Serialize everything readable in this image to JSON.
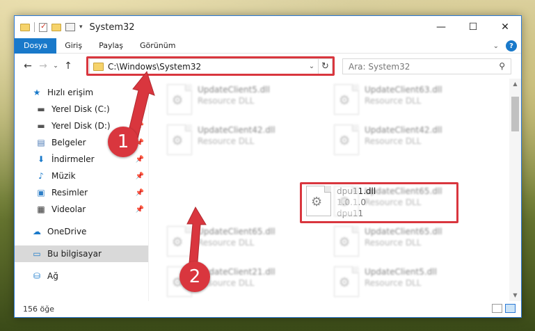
{
  "window": {
    "title": "System32",
    "controls": {
      "minimize": "—",
      "maximize": "☐",
      "close": "✕"
    }
  },
  "ribbon": {
    "tabs": [
      "Dosya",
      "Giriş",
      "Paylaş",
      "Görünüm"
    ],
    "active_tab": "Dosya",
    "help": "?"
  },
  "navigation": {
    "back": "←",
    "forward": "→",
    "recent": "⌄",
    "up": "↑",
    "address_path": "C:\\Windows\\System32",
    "search_placeholder": "Ara: System32"
  },
  "sidebar": {
    "quick_access_label": "Hızlı erişim",
    "quick_access_items": [
      {
        "label": "Yerel Disk (C:)",
        "icon": "drive-icon"
      },
      {
        "label": "Yerel Disk (D:)",
        "icon": "drive-icon"
      },
      {
        "label": "Belgeler",
        "icon": "documents-icon"
      },
      {
        "label": "İndirmeler",
        "icon": "downloads-icon"
      },
      {
        "label": "Müzik",
        "icon": "music-icon"
      },
      {
        "label": "Resimler",
        "icon": "pictures-icon"
      },
      {
        "label": "Videolar",
        "icon": "videos-icon"
      }
    ],
    "onedrive": "OneDrive",
    "this_pc": "Bu bilgisayar",
    "network": "Ağ"
  },
  "files": [
    {
      "name": "UpdateClient5.dll",
      "sub1": "Resource DLL",
      "sub2": "",
      "blurred": true
    },
    {
      "name": "UpdateClient63.dll",
      "sub1": "Resource DLL",
      "sub2": "",
      "blurred": true
    },
    {
      "name": "UpdateClient42.dll",
      "sub1": "Resource DLL",
      "sub2": "",
      "blurred": true
    },
    {
      "name": "UpdateClient42.dll",
      "sub1": "Resource DLL",
      "sub2": "",
      "blurred": true
    },
    {
      "name": "dpu11.dll",
      "sub1": "1.0.1.0",
      "sub2": "dpu11",
      "blurred": false
    },
    {
      "name": "UpdateClient65.dll",
      "sub1": "Resource DLL",
      "sub2": "",
      "blurred": true
    },
    {
      "name": "UpdateClient65.dll",
      "sub1": "Resource DLL",
      "sub2": "",
      "blurred": true
    },
    {
      "name": "UpdateClient65.dll",
      "sub1": "Resource DLL",
      "sub2": "",
      "blurred": true
    },
    {
      "name": "UpdateClient21.dll",
      "sub1": "Resource DLL",
      "sub2": "",
      "blurred": true
    },
    {
      "name": "UpdateClient5.dll",
      "sub1": "Resource DLL",
      "sub2": "",
      "blurred": true
    }
  ],
  "status": {
    "item_count": "156 öğe"
  },
  "callouts": {
    "one": "1",
    "two": "2",
    "color": "#d9363e"
  }
}
